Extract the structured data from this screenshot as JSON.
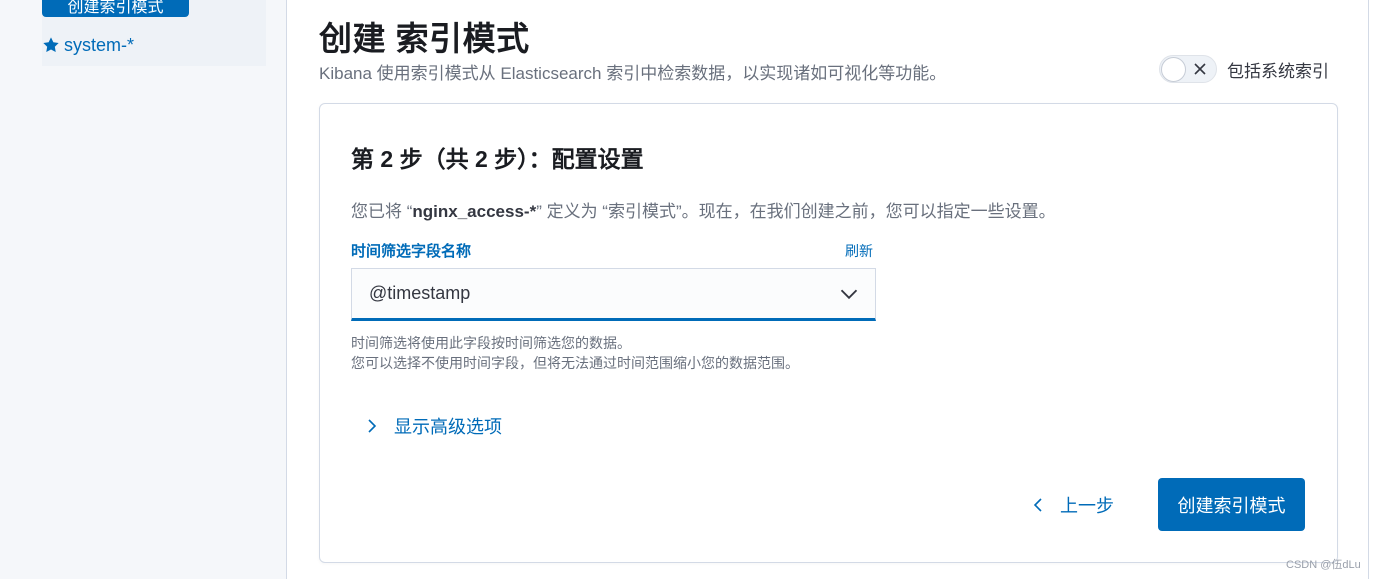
{
  "sidebar": {
    "create_button_label": "创建索引模式",
    "items": [
      {
        "label": "system-*",
        "icon": "star-icon"
      }
    ]
  },
  "header": {
    "title": "创建 索引模式",
    "description": "Kibana 使用索引模式从 Elasticsearch 索引中检索数据，以实现诸如可视化等功能。",
    "include_system_toggle": {
      "label": "包括系统索引",
      "checked": false
    }
  },
  "step": {
    "title": "第 2 步（共 2 步）：配置设置",
    "desc_prefix": "您已将 “",
    "index_pattern": "nginx_access-*",
    "desc_suffix": "” 定义为 “索引模式”。现在，在我们创建之前，您可以指定一些设置。",
    "time_field": {
      "label": "时间筛选字段名称",
      "refresh_label": "刷新",
      "value": "@timestamp",
      "help_line1": "时间筛选将使用此字段按时间筛选您的数据。",
      "help_line2": "您可以选择不使用时间字段，但将无法通过时间范围缩小您的数据范围。"
    },
    "advanced_label": "显示高级选项",
    "back_label": "上一步",
    "create_label": "创建索引模式"
  },
  "watermark": "CSDN @伍dLu",
  "colors": {
    "accent": "#006bb8",
    "title": "#1a1c21",
    "muted": "#69707d",
    "border": "#d3dae6"
  }
}
